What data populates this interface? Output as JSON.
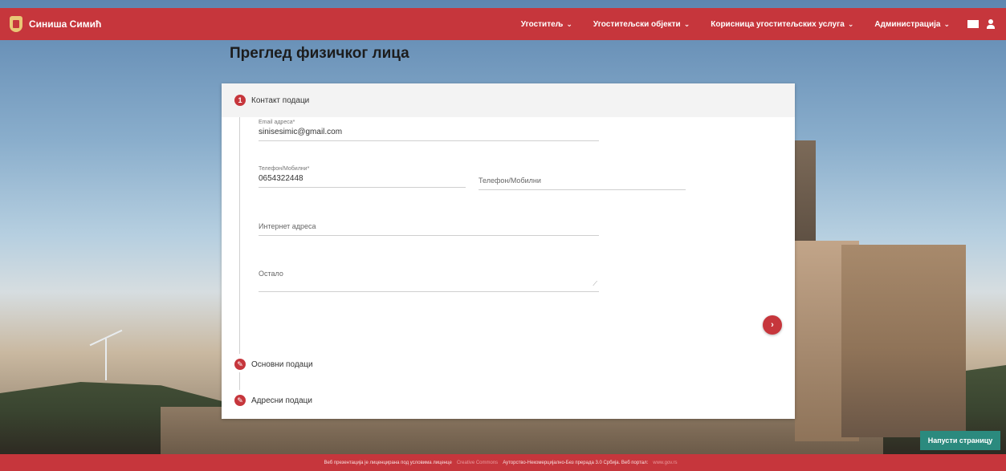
{
  "header": {
    "user_name": "Синиша Симић",
    "nav": [
      {
        "label": "Угоститељ"
      },
      {
        "label": "Угоститељски објекти"
      },
      {
        "label": "Корисница угоститељских услуга"
      },
      {
        "label": "Администрација"
      }
    ],
    "chevron": "⌄"
  },
  "page": {
    "title": "Преглед физичког лица"
  },
  "steps": [
    {
      "number": "1",
      "label": "Контакт подаци"
    },
    {
      "icon": "pencil-icon",
      "label": "Основни подаци"
    },
    {
      "icon": "pencil-icon",
      "label": "Адресни подаци"
    }
  ],
  "form": {
    "email": {
      "label": "Email адреса*",
      "value": "sinisesimic@gmail.com"
    },
    "phone": {
      "label": "Телефон/Мобилни*",
      "value": "0654322448"
    },
    "phone2": {
      "placeholder": "Телефон/Мобилни"
    },
    "website": {
      "placeholder": "Интернет адреса"
    },
    "other": {
      "placeholder": "Остало"
    },
    "next": "›"
  },
  "leave_button": "Напусти страницу",
  "footer": {
    "text": "Веб презентација је лиценцирана под условима лиценце",
    "link1": "Creative Commons",
    "text2": "Ауторство-Некомерцијално-Без прерада 3.0 Србија. Веб портал:",
    "link2": "www.gov.rs"
  },
  "colors": {
    "primary": "#c6363c",
    "leave": "#2b8a7e"
  }
}
